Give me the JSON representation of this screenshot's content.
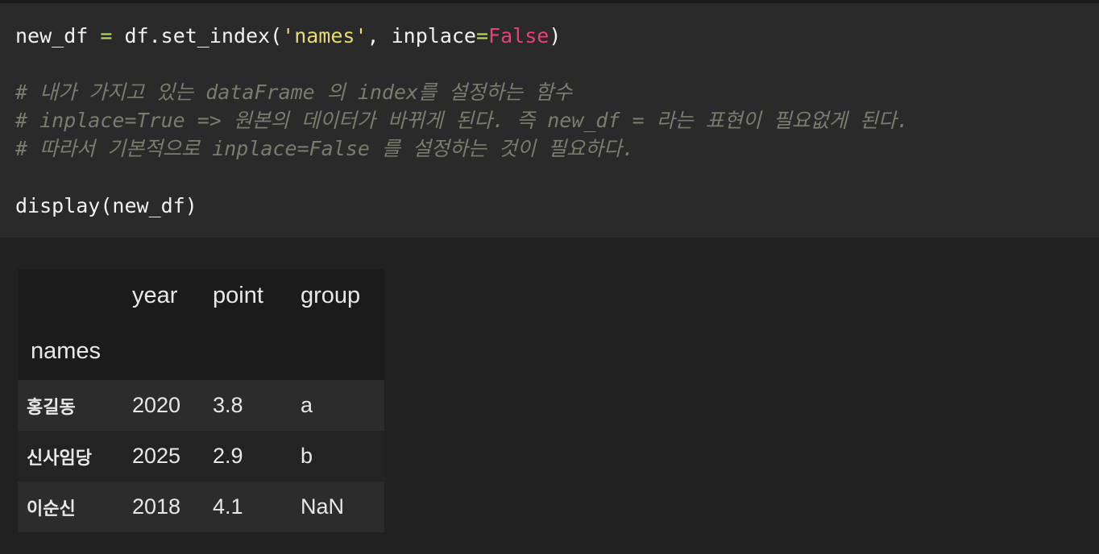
{
  "code_cell": {
    "line1": {
      "var": "new_df",
      "space1": " ",
      "eq": "=",
      "call": " df.set_index(",
      "string": "'names'",
      "param": ", inplace",
      "eq2": "=",
      "value": "False",
      "close": ")"
    },
    "comment1": "# 내가 가지고 있는 dataFrame 의 index를 설정하는 함수",
    "comment2": "# inplace=True => 원본의 데이터가 바뀌게 된다. 즉 new_df = 라는 표현이 필요없게 된다.",
    "comment3": "# 따라서 기본적으로 inplace=False 를 설정하는 것이 필요하다.",
    "line_display": "display(new_df)"
  },
  "output": {
    "columns": [
      "year",
      "point",
      "group"
    ],
    "index_name": "names",
    "rows": [
      {
        "index": "홍길동",
        "year": "2020",
        "point": "3.8",
        "group": "a"
      },
      {
        "index": "신사임당",
        "year": "2025",
        "point": "2.9",
        "group": "b"
      },
      {
        "index": "이순신",
        "year": "2018",
        "point": "4.1",
        "group": "NaN"
      }
    ]
  }
}
